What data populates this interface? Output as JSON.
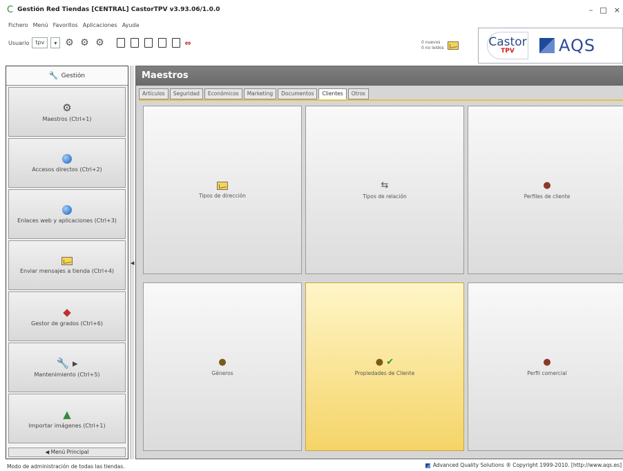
{
  "window": {
    "title": "Gestión Red Tiendas [CENTRAL] CastorTPV v3.93.06/1.0.0",
    "minimize": "–",
    "maximize": "□",
    "close": "×"
  },
  "menu": [
    "Fichero",
    "Menú",
    "Favoritos",
    "Aplicaciones",
    "Ayuda"
  ],
  "userbar": {
    "label": "Usuario",
    "user_value": "tpv"
  },
  "inbox": {
    "line1": "0 nuevos",
    "line2": "0 no leídos"
  },
  "brand": {
    "castor": "Castor",
    "tpv": "TPV",
    "aqs": "AQS"
  },
  "left_panel": {
    "title": "Gestión",
    "items": [
      {
        "label": "Maestros (Ctrl+1)",
        "icon": "gear-icon"
      },
      {
        "label": "Accesos directos (Ctrl+2)",
        "icon": "globe-icon"
      },
      {
        "label": "Enlaces web y aplicaciones (Ctrl+3)",
        "icon": "globe-icon"
      },
      {
        "label": "Enviar mensajes a tienda (Ctrl+4)",
        "icon": "envelope-icon"
      },
      {
        "label": "Gestor de grados (Ctrl+6)",
        "icon": "bucket-icon"
      },
      {
        "label": "Mantenimiento (Ctrl+5)",
        "icon": "wrench-icon"
      },
      {
        "label": "Importar imágenes (Ctrl+1)",
        "icon": "image-icon"
      }
    ],
    "footer": "◀ Menú Principal"
  },
  "main": {
    "title": "Maestros",
    "tabs": [
      "Artículos",
      "Seguridad",
      "Económicos",
      "Marketing",
      "Documentos",
      "Clientes",
      "Otros"
    ],
    "active_tab": "Clientes",
    "tiles": [
      {
        "label": "Tipos de dirección",
        "icon": "envelope-icon"
      },
      {
        "label": "Tipos de relación",
        "icon": "relation-icon"
      },
      {
        "label": "Perfiles de cliente",
        "icon": "profile-icon"
      },
      {
        "label": "Géneros",
        "icon": "people-icon"
      },
      {
        "label": "Propiedades de Cliente",
        "icon": "people-check-icon"
      },
      {
        "label": "Perfil comercial",
        "icon": "profile-icon"
      }
    ],
    "accent_color": "#e8c23a"
  },
  "status": {
    "left": "Modo de administración de todas las tiendas.",
    "right": "Advanced Quality Solutions ® Copyright 1999-2010. [http://www.aqs.es]"
  }
}
